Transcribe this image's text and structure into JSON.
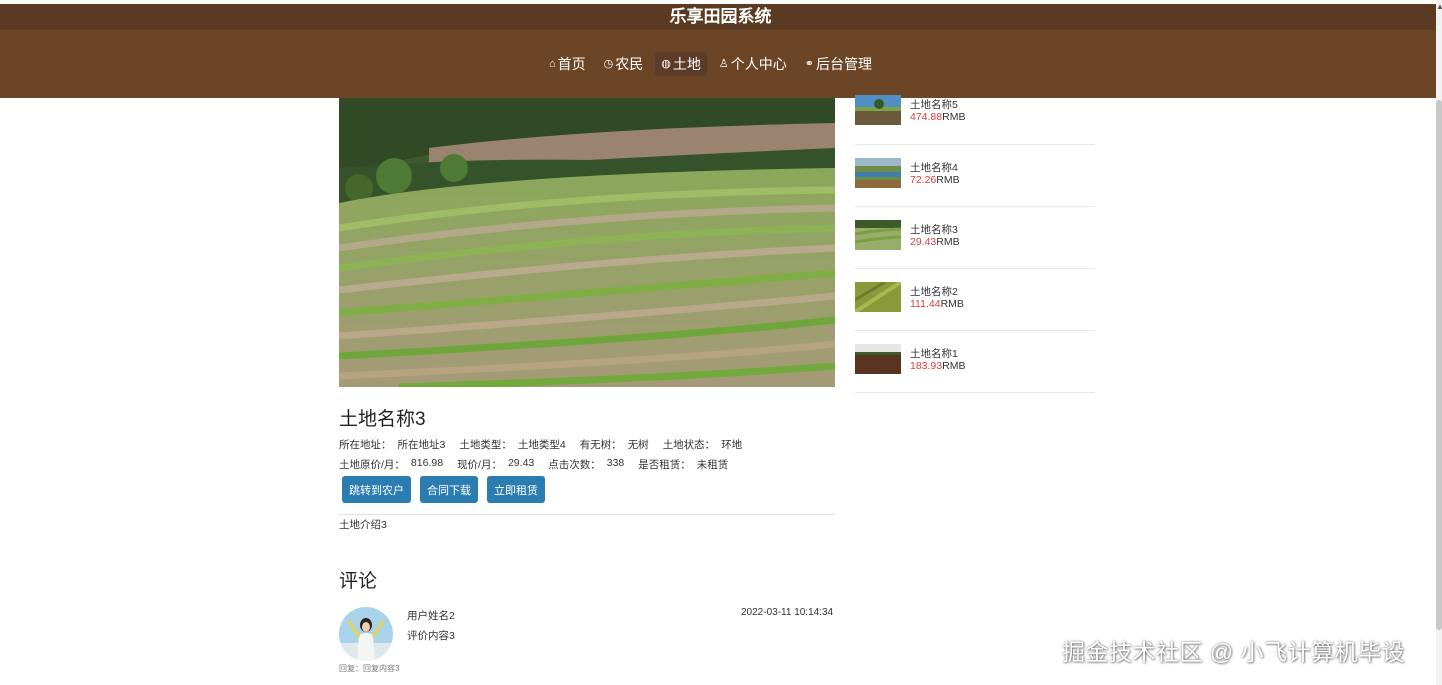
{
  "header": {
    "title": "乐享田园系统",
    "nav": [
      {
        "icon": "home-icon",
        "glyph": "⌂",
        "label": "首页",
        "active": false
      },
      {
        "icon": "clock-icon",
        "glyph": "◷",
        "label": "农民",
        "active": false
      },
      {
        "icon": "land-icon",
        "glyph": "◍",
        "label": "土地",
        "active": true
      },
      {
        "icon": "user-icon",
        "glyph": "♙",
        "label": "个人中心",
        "active": false
      },
      {
        "icon": "link-icon",
        "glyph": "⚭",
        "label": "后台管理",
        "active": false
      }
    ]
  },
  "detail": {
    "title": "土地名称3",
    "row1": [
      {
        "label": "所在地址：",
        "value": "所在地址3"
      },
      {
        "label": "土地类型：",
        "value": "土地类型4"
      },
      {
        "label": "有无树：",
        "value": "无树"
      },
      {
        "label": "土地状态：",
        "value": "环地"
      }
    ],
    "row2": [
      {
        "label": "土地原价/月：",
        "value": "816.98"
      },
      {
        "label": "现价/月：",
        "value": "29.43"
      },
      {
        "label": "点击次数：",
        "value": "338"
      },
      {
        "label": "是否租赁：",
        "value": "未租赁"
      }
    ],
    "buttons": {
      "jump": "跳转到农户",
      "download": "合同下载",
      "rent": "立即租赁"
    },
    "intro": "土地介绍3"
  },
  "comments": {
    "heading": "评论",
    "items": [
      {
        "user": "用户姓名2",
        "text": "评价内容3",
        "time": "2022-03-11 10:14:34",
        "reply": "回复：回复内容3"
      }
    ]
  },
  "sidebar": {
    "items": [
      {
        "name": "土地名称5",
        "price": "474.88",
        "unit": "RMB"
      },
      {
        "name": "土地名称4",
        "price": "72.26",
        "unit": "RMB"
      },
      {
        "name": "土地名称3",
        "price": "29.43",
        "unit": "RMB"
      },
      {
        "name": "土地名称2",
        "price": "111.44",
        "unit": "RMB"
      },
      {
        "name": "土地名称1",
        "price": "183.93",
        "unit": "RMB"
      }
    ]
  },
  "watermark": "掘金技术社区 @ 小飞计算机毕设",
  "colors": {
    "header_bg": "#6b4526",
    "title_bg": "#5a3a22",
    "button": "#2a7cb1",
    "price": "#e23a3a"
  }
}
